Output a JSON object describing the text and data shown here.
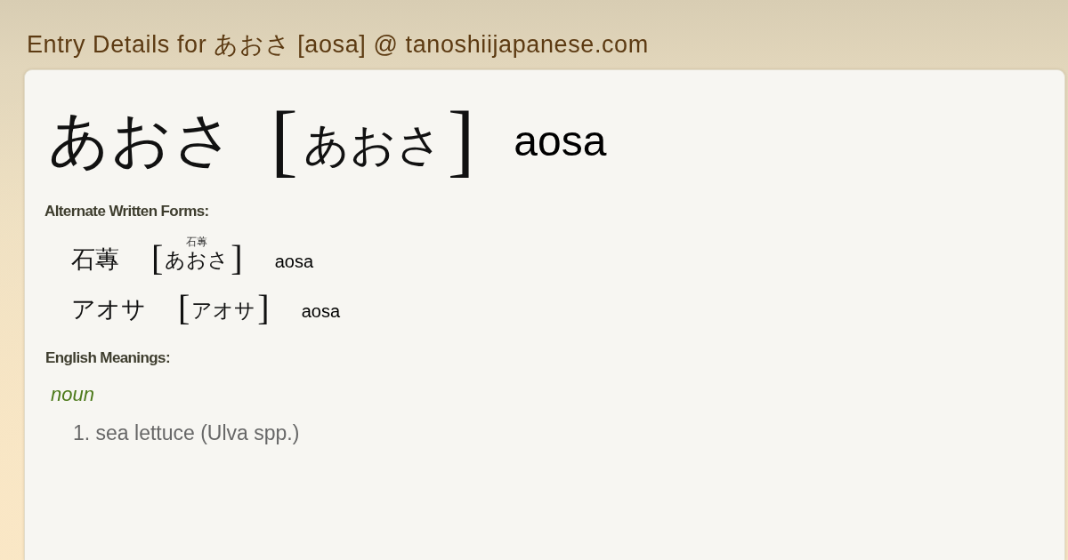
{
  "page_title": "Entry Details for あおさ [aosa] @ tanoshiijapanese.com",
  "entry": {
    "headword": "あおさ",
    "bracket_left": "[",
    "reading": "あおさ",
    "bracket_right": "]",
    "romaji": "aosa"
  },
  "alternate_forms": {
    "heading": "Alternate Written Forms:",
    "forms": [
      {
        "written": "石蓴",
        "bracket_left": "[",
        "ruby": "石蓴",
        "reading": "あおさ",
        "bracket_right": "]",
        "romaji": "aosa"
      },
      {
        "written": "アオサ",
        "bracket_left": "[",
        "reading": "アオサ",
        "bracket_right": "]",
        "romaji": "aosa"
      }
    ]
  },
  "english_meanings": {
    "heading": "English Meanings:",
    "groups": [
      {
        "part_of_speech": "noun",
        "senses": [
          "1. sea lettuce (Ulva spp.)"
        ]
      }
    ]
  }
}
